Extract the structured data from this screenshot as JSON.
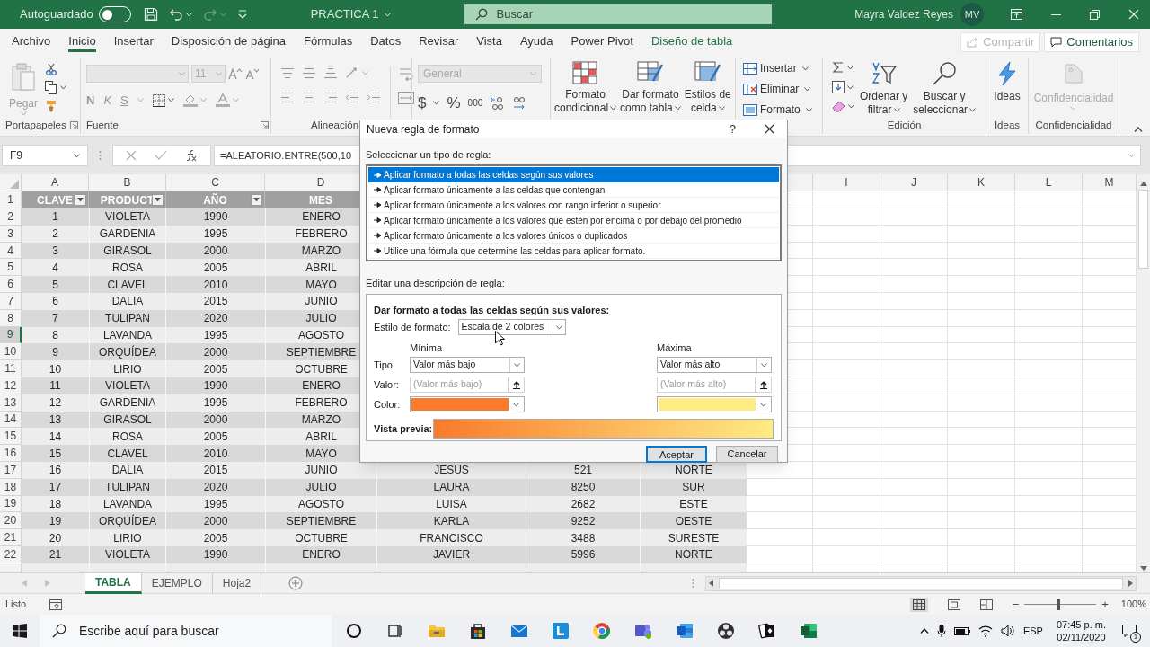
{
  "title_bar": {
    "autosave_label": "Autoguardado",
    "autosave_on": false,
    "document_title": "PRACTICA 1",
    "search_placeholder": "Buscar",
    "user_name": "Mayra Valdez Reyes",
    "user_initials": "MV"
  },
  "ribbon_tabs": [
    {
      "label": "Archivo",
      "selected": false,
      "kind": "plain"
    },
    {
      "label": "Inicio",
      "selected": true,
      "kind": "plain"
    },
    {
      "label": "Insertar",
      "selected": false,
      "kind": "plain"
    },
    {
      "label": "Disposición de página",
      "selected": false,
      "kind": "plain"
    },
    {
      "label": "Fórmulas",
      "selected": false,
      "kind": "plain"
    },
    {
      "label": "Datos",
      "selected": false,
      "kind": "plain"
    },
    {
      "label": "Revisar",
      "selected": false,
      "kind": "plain"
    },
    {
      "label": "Vista",
      "selected": false,
      "kind": "plain"
    },
    {
      "label": "Ayuda",
      "selected": false,
      "kind": "plain"
    },
    {
      "label": "Power Pivot",
      "selected": false,
      "kind": "plain"
    },
    {
      "label": "Diseño de tabla",
      "selected": false,
      "kind": "contextual"
    }
  ],
  "share_button": {
    "label": "Compartir",
    "disabled": true
  },
  "comments_button": {
    "label": "Comentarios"
  },
  "ribbon": {
    "clipboard": {
      "paste_label": "Pegar",
      "group_label": "Portapapeles"
    },
    "font": {
      "size": "11",
      "bold": "N",
      "italic": "K",
      "underline": "S",
      "group_label": "Fuente"
    },
    "alignment": {
      "group_label": "Alineación"
    },
    "number": {
      "format": "General",
      "currency": "$",
      "percent": "%",
      "thousands": "000"
    },
    "styles": [
      {
        "lines": [
          "Formato",
          "condicional"
        ]
      },
      {
        "lines": [
          "Dar formato",
          "como tabla"
        ]
      },
      {
        "lines": [
          "Estilos de",
          "celda"
        ]
      }
    ],
    "cells": [
      "Insertar",
      "Eliminar",
      "Formato"
    ],
    "editing": {
      "sort_lines": [
        "Ordenar y",
        "filtrar"
      ],
      "find_lines": [
        "Buscar y",
        "seleccionar"
      ],
      "group_label": "Edición"
    },
    "ideas": {
      "label": "Ideas",
      "group_label": "Ideas"
    },
    "sensitivity": {
      "label": "Confidencialidad",
      "group_label": "Confidencialidad",
      "disabled": true
    }
  },
  "formula_bar": {
    "name_box": "F9",
    "formula": "=ALEATORIO.ENTRE(500,10"
  },
  "sheet": {
    "column_letters_left": [
      "A",
      "B",
      "C",
      "D"
    ],
    "column_letters_right": [
      "I",
      "J",
      "K",
      "L",
      "M"
    ],
    "header": {
      "number": "1",
      "selected": false,
      "cells": [
        {
          "label": "CLAVE",
          "filter": true
        },
        {
          "label": "PRODUCT",
          "filter": true
        },
        {
          "label": "AÑO",
          "filter": true
        },
        {
          "label": "MES",
          "filter": false
        }
      ]
    },
    "rows": [
      {
        "number": "2",
        "selected": false,
        "cells": [
          "1",
          "VIOLETA",
          "1990",
          "ENERO"
        ]
      },
      {
        "number": "3",
        "selected": false,
        "cells": [
          "2",
          "GARDENIA",
          "1995",
          "FEBRERO"
        ]
      },
      {
        "number": "4",
        "selected": false,
        "cells": [
          "3",
          "GIRASOL",
          "2000",
          "MARZO"
        ]
      },
      {
        "number": "5",
        "selected": false,
        "cells": [
          "4",
          "ROSA",
          "2005",
          "ABRIL"
        ]
      },
      {
        "number": "6",
        "selected": false,
        "cells": [
          "5",
          "CLAVEL",
          "2010",
          "MAYO"
        ]
      },
      {
        "number": "7",
        "selected": false,
        "cells": [
          "6",
          "DALIA",
          "2015",
          "JUNIO"
        ]
      },
      {
        "number": "8",
        "selected": false,
        "cells": [
          "7",
          "TULIPAN",
          "2020",
          "JULIO"
        ]
      },
      {
        "number": "9",
        "selected": true,
        "cells": [
          "8",
          "LAVANDA",
          "1995",
          "AGOSTO"
        ]
      },
      {
        "number": "10",
        "selected": false,
        "cells": [
          "9",
          "ORQUÍDEA",
          "2000",
          "SEPTIEMBRE"
        ]
      },
      {
        "number": "11",
        "selected": false,
        "cells": [
          "10",
          "LIRIO",
          "2005",
          "OCTUBRE"
        ]
      },
      {
        "number": "12",
        "selected": false,
        "cells": [
          "11",
          "VIOLETA",
          "1990",
          "ENERO"
        ]
      },
      {
        "number": "13",
        "selected": false,
        "cells": [
          "12",
          "GARDENIA",
          "1995",
          "FEBRERO"
        ]
      },
      {
        "number": "14",
        "selected": false,
        "cells": [
          "13",
          "GIRASOL",
          "2000",
          "MARZO"
        ]
      },
      {
        "number": "15",
        "selected": false,
        "cells": [
          "14",
          "ROSA",
          "2005",
          "ABRIL"
        ]
      },
      {
        "number": "16",
        "selected": false,
        "cells": [
          "15",
          "CLAVEL",
          "2010",
          "MAYO"
        ]
      },
      {
        "number": "17",
        "selected": false,
        "cells": [
          "16",
          "DALIA",
          "2015",
          "JUNIO",
          "JESUS",
          "521",
          "NORTE"
        ]
      },
      {
        "number": "18",
        "selected": false,
        "cells": [
          "17",
          "TULIPAN",
          "2020",
          "JULIO",
          "LAURA",
          "8250",
          "SUR"
        ]
      },
      {
        "number": "19",
        "selected": false,
        "cells": [
          "18",
          "LAVANDA",
          "1995",
          "AGOSTO",
          "LUISA",
          "2682",
          "ESTE"
        ]
      },
      {
        "number": "20",
        "selected": false,
        "cells": [
          "19",
          "ORQUÍDEA",
          "2000",
          "SEPTIEMBRE",
          "KARLA",
          "9252",
          "OESTE"
        ]
      },
      {
        "number": "21",
        "selected": false,
        "cells": [
          "20",
          "LIRIO",
          "2005",
          "OCTUBRE",
          "FRANCISCO",
          "3488",
          "SURESTE"
        ]
      },
      {
        "number": "22",
        "selected": false,
        "cells": [
          "21",
          "VIOLETA",
          "1990",
          "ENERO",
          "JAVIER",
          "5996",
          "NORTE"
        ]
      }
    ]
  },
  "dialog": {
    "title": "Nueva regla de formato",
    "help": "?",
    "rule_type_label": "Seleccionar un tipo de regla:",
    "rule_types": [
      {
        "label": "Aplicar formato a todas las celdas según sus valores",
        "selected": true
      },
      {
        "label": "Aplicar formato únicamente a las celdas que contengan",
        "selected": false
      },
      {
        "label": "Aplicar formato únicamente a los valores con rango inferior o superior",
        "selected": false
      },
      {
        "label": "Aplicar formato únicamente a los valores que estén por encima o por debajo del promedio",
        "selected": false
      },
      {
        "label": "Aplicar formato únicamente a los valores únicos o duplicados",
        "selected": false
      },
      {
        "label": "Utilice una fórmula que determine las celdas para aplicar formato.",
        "selected": false
      }
    ],
    "description_label": "Editar una descripción de regla:",
    "description_heading": "Dar formato a todas las celdas según sus valores:",
    "style_label": "Estilo de formato:",
    "style_value": "Escala de 2 colores",
    "type_label": "Tipo:",
    "value_label": "Valor:",
    "color_label": "Color:",
    "min": {
      "heading": "Mínima",
      "type": "Valor más bajo",
      "value_placeholder": "(Valor más bajo)",
      "color": "#f97b2c"
    },
    "max": {
      "heading": "Máxima",
      "type": "Valor más alto",
      "value_placeholder": "(Valor más alto)",
      "color": "#ffeb84"
    },
    "preview_label": "Vista previa:",
    "ok": "Aceptar",
    "cancel": "Cancelar"
  },
  "sheet_tabs": [
    {
      "label": "TABLA",
      "selected": true
    },
    {
      "label": "EJEMPLO",
      "selected": false
    },
    {
      "label": "Hoja2",
      "selected": false
    }
  ],
  "status_bar": {
    "status": "Listo",
    "zoom_out": "−",
    "zoom_in": "+",
    "zoom": "100%",
    "level": 0.45
  },
  "taskbar": {
    "search_placeholder": "Escribe aquí para buscar",
    "language": "ESP",
    "time": "07:45 p. m.",
    "date": "02/11/2020",
    "notifications": "1"
  }
}
